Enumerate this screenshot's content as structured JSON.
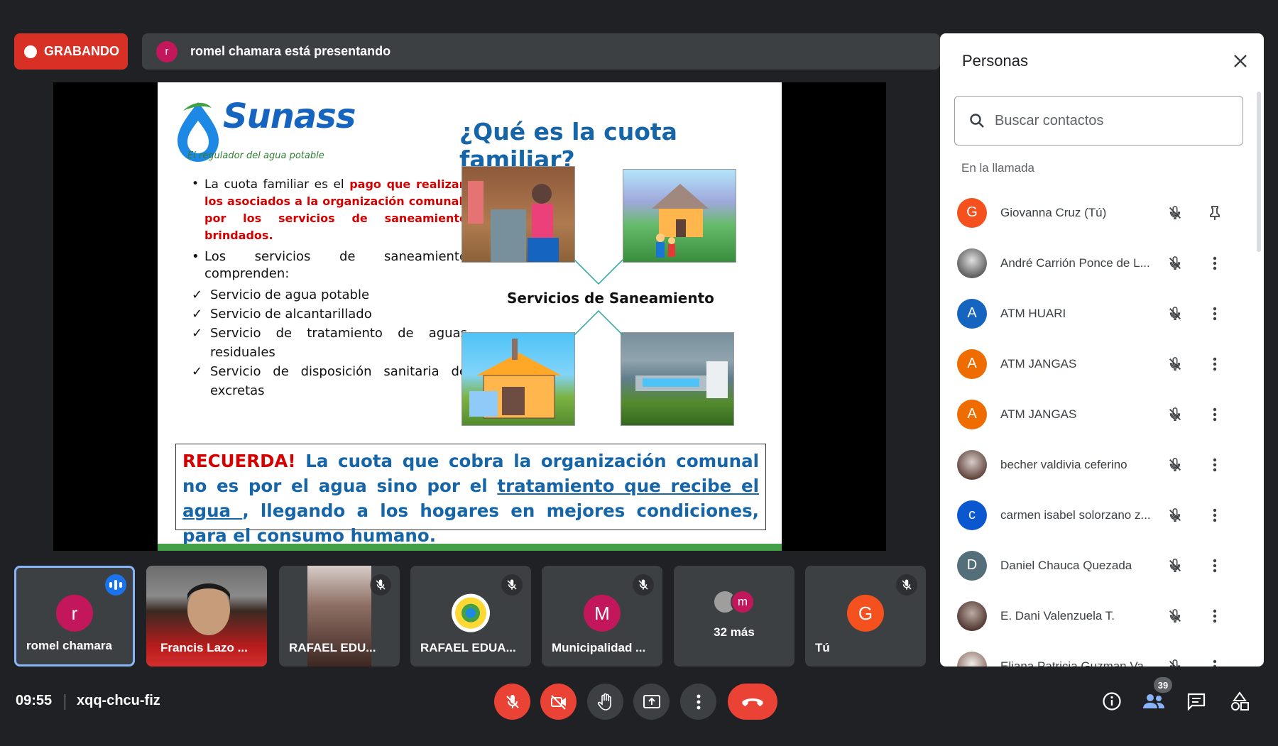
{
  "recording": {
    "label": "GRABANDO"
  },
  "presenter_bar": {
    "avatar_initial": "r",
    "text": "romel chamara está presentando"
  },
  "slide": {
    "logo_name": "Sunass",
    "logo_tagline": "El regulador del agua potable",
    "title": "¿Qué es la cuota familiar?",
    "bullet1_prefix": "La cuota familiar es el ",
    "bullet1_highlight": "pago que realizan los asociados a la organización comunal, por los servicios de saneamiento brindados.",
    "bullet2": "Los servicios de saneamiento comprenden:",
    "services": [
      "Servicio de agua potable",
      "Servicio de alcantarillado",
      "Servicio de tratamiento de aguas residuales",
      "Servicio de disposición sanitaria de excretas"
    ],
    "diagram_label": "Servicios de Saneamiento",
    "recuerda_label": "RECUERDA!",
    "recuerda_text1": " La cuota que cobra la organización comunal no es por el agua sino por el ",
    "recuerda_underline": "tratamiento que recibe el agua ",
    "recuerda_text2": ", llegando a los hogares en mejores condiciones, para el consumo humano."
  },
  "tiles": [
    {
      "name": "romel chamara",
      "initial": "r",
      "avatar_color": "#c2185b"
    },
    {
      "name": "Francis Lazo ..."
    },
    {
      "name": "RAFAEL EDU..."
    },
    {
      "name": "RAFAEL EDUA..."
    },
    {
      "name": "Municipalidad ...",
      "initial": "M",
      "avatar_color": "#c2185b"
    },
    {
      "name": "32 más",
      "initial": "m"
    },
    {
      "name": "Tú",
      "initial": "G",
      "avatar_color": "#f4511e"
    }
  ],
  "meeting": {
    "time": "09:55",
    "code": "xqq-chcu-fiz"
  },
  "people_panel": {
    "title": "Personas",
    "search_placeholder": "Buscar contactos",
    "section_label": "En la llamada",
    "participants_count": "39",
    "participants": [
      {
        "name": "Giovanna Cruz (Tú)",
        "initial": "G",
        "color": "#f4511e"
      },
      {
        "name": "André Carrión Ponce de L...",
        "initial": "",
        "color": "#9e9e9e"
      },
      {
        "name": "ATM HUARI",
        "initial": "A",
        "color": "#1565c0"
      },
      {
        "name": "ATM JANGAS",
        "initial": "A",
        "color": "#ef6c00"
      },
      {
        "name": "ATM JANGAS",
        "initial": "A",
        "color": "#ef6c00"
      },
      {
        "name": "becher valdivia ceferino",
        "initial": "",
        "color": "#8d6e63"
      },
      {
        "name": "carmen isabel solorzano z...",
        "initial": "c",
        "color": "#0b57d0"
      },
      {
        "name": "Daniel Chauca Quezada",
        "initial": "D",
        "color": "#546e7a"
      },
      {
        "name": "E. Dani Valenzuela T.",
        "initial": "",
        "color": "#6d4c41"
      },
      {
        "name": "Eliana Patricia Guzman Va...",
        "initial": "",
        "color": "#a1887f"
      }
    ]
  }
}
